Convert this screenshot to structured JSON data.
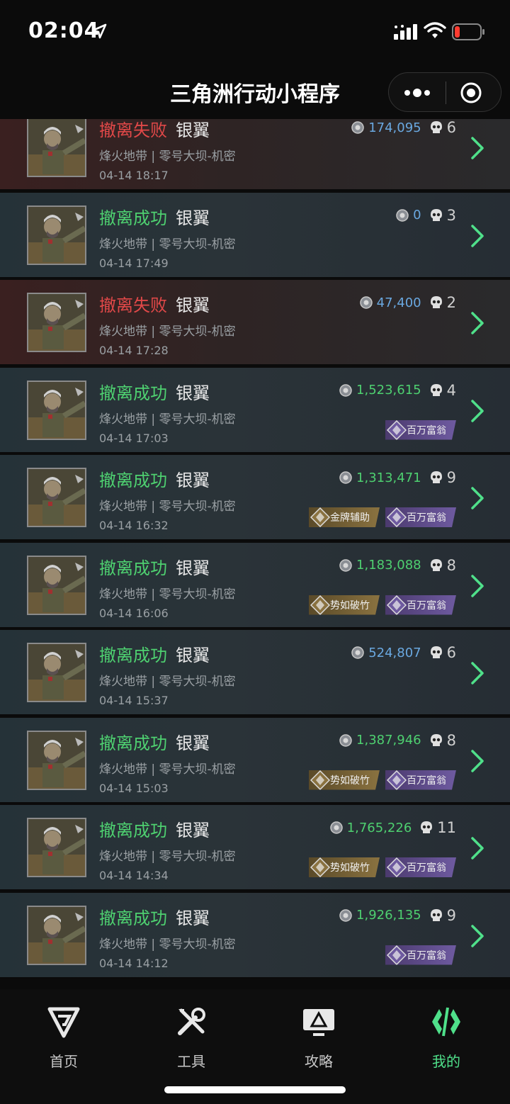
{
  "status_bar": {
    "time": "02:04"
  },
  "nav": {
    "title": "三角洲行动小程序"
  },
  "rows": [
    {
      "status": "撤离失败",
      "result": "fail",
      "rank": "银翼",
      "mode": "烽火地带 | 零号大坝-机密",
      "time": "04-14 18:17",
      "money": "174,095",
      "money_tone": "neutral",
      "kills": "6",
      "badges": []
    },
    {
      "status": "撤离成功",
      "result": "success",
      "rank": "银翼",
      "mode": "烽火地带 | 零号大坝-机密",
      "time": "04-14 17:49",
      "money": "0",
      "money_tone": "neutral",
      "kills": "3",
      "badges": []
    },
    {
      "status": "撤离失败",
      "result": "fail",
      "rank": "银翼",
      "mode": "烽火地带 | 零号大坝-机密",
      "time": "04-14 17:28",
      "money": "47,400",
      "money_tone": "neutral",
      "kills": "2",
      "badges": []
    },
    {
      "status": "撤离成功",
      "result": "success",
      "rank": "银翼",
      "mode": "烽火地带 | 零号大坝-机密",
      "time": "04-14 17:03",
      "money": "1,523,615",
      "money_tone": "pos",
      "kills": "4",
      "badges": [
        {
          "label": "百万富翁",
          "tone": "purple"
        }
      ]
    },
    {
      "status": "撤离成功",
      "result": "success",
      "rank": "银翼",
      "mode": "烽火地带 | 零号大坝-机密",
      "time": "04-14 16:32",
      "money": "1,313,471",
      "money_tone": "pos",
      "kills": "9",
      "badges": [
        {
          "label": "金牌辅助",
          "tone": "gold"
        },
        {
          "label": "百万富翁",
          "tone": "purple"
        }
      ]
    },
    {
      "status": "撤离成功",
      "result": "success",
      "rank": "银翼",
      "mode": "烽火地带 | 零号大坝-机密",
      "time": "04-14 16:06",
      "money": "1,183,088",
      "money_tone": "pos",
      "kills": "8",
      "badges": [
        {
          "label": "势如破竹",
          "tone": "gold"
        },
        {
          "label": "百万富翁",
          "tone": "purple"
        }
      ]
    },
    {
      "status": "撤离成功",
      "result": "success",
      "rank": "银翼",
      "mode": "烽火地带 | 零号大坝-机密",
      "time": "04-14 15:37",
      "money": "524,807",
      "money_tone": "neutral",
      "kills": "6",
      "badges": []
    },
    {
      "status": "撤离成功",
      "result": "success",
      "rank": "银翼",
      "mode": "烽火地带 | 零号大坝-机密",
      "time": "04-14 15:03",
      "money": "1,387,946",
      "money_tone": "pos",
      "kills": "8",
      "badges": [
        {
          "label": "势如破竹",
          "tone": "gold"
        },
        {
          "label": "百万富翁",
          "tone": "purple"
        }
      ]
    },
    {
      "status": "撤离成功",
      "result": "success",
      "rank": "银翼",
      "mode": "烽火地带 | 零号大坝-机密",
      "time": "04-14 14:34",
      "money": "1,765,226",
      "money_tone": "pos",
      "kills": "11",
      "badges": [
        {
          "label": "势如破竹",
          "tone": "gold"
        },
        {
          "label": "百万富翁",
          "tone": "purple"
        }
      ]
    },
    {
      "status": "撤离成功",
      "result": "success",
      "rank": "银翼",
      "mode": "烽火地带 | 零号大坝-机密",
      "time": "04-14 14:12",
      "money": "1,926,135",
      "money_tone": "pos",
      "kills": "9",
      "badges": [
        {
          "label": "百万富翁",
          "tone": "purple"
        }
      ]
    }
  ],
  "tabs": [
    {
      "label": "首页",
      "icon": "logo-icon",
      "active": false
    },
    {
      "label": "工具",
      "icon": "tools-icon",
      "active": false
    },
    {
      "label": "攻略",
      "icon": "guide-icon",
      "active": false
    },
    {
      "label": "我的",
      "icon": "profile-icon",
      "active": true
    }
  ],
  "colors": {
    "success": "#4ed070",
    "fail": "#e04848",
    "active_tab": "#4fe08a"
  }
}
